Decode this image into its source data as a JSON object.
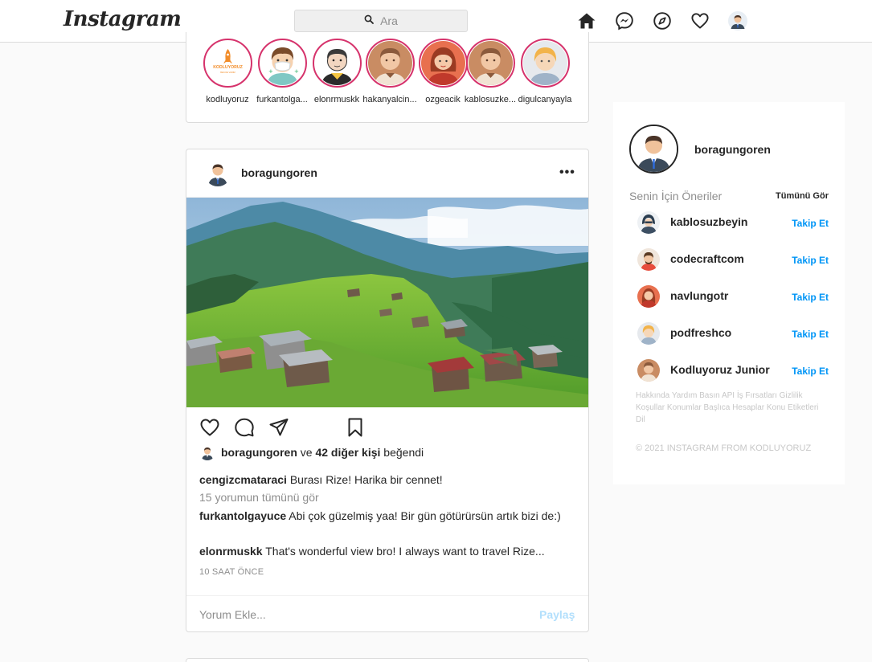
{
  "header": {
    "logo": "Instagram",
    "search_placeholder": "Ara",
    "icons": [
      "home-icon",
      "messenger-icon",
      "explore-icon",
      "heart-icon",
      "profile-avatar"
    ]
  },
  "stories": [
    {
      "name": "kodluyoruz"
    },
    {
      "name": "furkantolga..."
    },
    {
      "name": "elonrmuskk"
    },
    {
      "name": "hakanyalcin..."
    },
    {
      "name": "ozgeacik"
    },
    {
      "name": "kablosuzke..."
    },
    {
      "name": "digulcanyayla"
    }
  ],
  "post": {
    "username": "boragungoren",
    "more_label": "•••",
    "likes": {
      "user": "boragungoren",
      "connector": " ve ",
      "others": "42 diğer kişi",
      "suffix": " beğendi"
    },
    "caption": {
      "user": "cengizcmataraci",
      "text": " Burası Rize! Harika bir cennet!"
    },
    "view_all": "15 yorumun tümünü gör",
    "comments": [
      {
        "user": "furkantolgayuce",
        "text": " Abi çok güzelmiş yaa! Bir gün götürürsün artık bizi de:)"
      },
      {
        "user": "elonrmuskk",
        "text": " That's wonderful view bro! I always want to travel Rize..."
      }
    ],
    "time": "10 SAAT ÖNCE",
    "comment_placeholder": "Yorum Ekle...",
    "share_label": "Paylaş"
  },
  "sidebar": {
    "username": "boragungoren",
    "suggestions_title": "Senin İçin Öneriler",
    "see_all": "Tümünü Gör",
    "follow_label": "Takip Et",
    "suggestions": [
      {
        "name": "kablosuzbeyin"
      },
      {
        "name": "codecraftcom"
      },
      {
        "name": "navlungotr"
      },
      {
        "name": "podfreshco"
      },
      {
        "name": "Kodluyoruz Junior"
      }
    ],
    "links": [
      "Hakkında",
      "Yardım",
      "Basın",
      "API",
      "İş Fırsatları",
      "Gizlilik",
      "Koşullar",
      "Konumlar",
      "Başlıca Hesaplar",
      "Konu Etiketleri",
      "Dil"
    ],
    "copyright": "© 2021 INSTAGRAM FROM KODLUYORUZ"
  },
  "colors": {
    "story_ring": "#d6336c",
    "link_blue": "#0095f6",
    "share_disabled": "#b2dffc",
    "muted": "#8e8e8e"
  }
}
